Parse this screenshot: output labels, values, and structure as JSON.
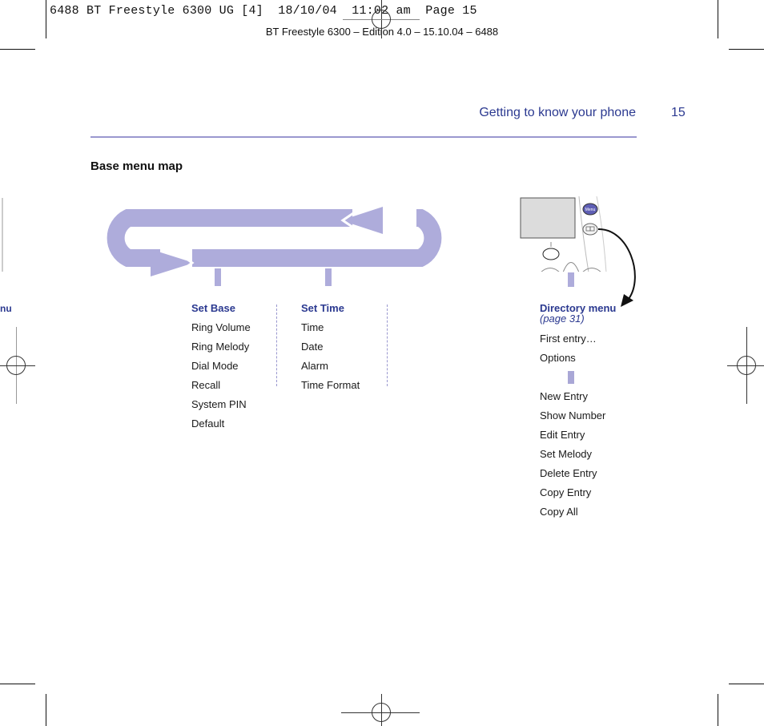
{
  "print_slug": "6488 BT Freestyle 6300 UG [4]  18/10/04  11:02 am  Page 15",
  "edition_line": "BT Freestyle 6300 – Edition 4.0 – 15.10.04 – 6488",
  "header": {
    "chapter_title": "Getting to know your phone",
    "page_number": "15"
  },
  "section": {
    "title": "Base menu map"
  },
  "left_margin_partial_text": "nu",
  "menus": {
    "set_base": {
      "heading": "Set Base",
      "items": [
        "Ring Volume",
        "Ring Melody",
        "Dial Mode",
        "Recall",
        "System PIN",
        "Default"
      ]
    },
    "set_time": {
      "heading": "Set Time",
      "items": [
        "Time",
        "Date",
        "Alarm",
        "Time Format"
      ]
    },
    "directory": {
      "heading": "Directory menu",
      "subheading": "(page 31)",
      "items_top": [
        "First entry…",
        "Options"
      ],
      "items_options": [
        "New Entry",
        "Show Number",
        "Edit Entry",
        "Set Melody",
        "Delete Entry",
        "Copy Entry",
        "Copy All"
      ]
    }
  },
  "handset_illustration": {
    "menu_button_label": "Menu",
    "directory_button_icon": "book-icon"
  },
  "colors": {
    "accent_blue": "#2b3990",
    "loop_lilac": "#aeacdb",
    "rule_lilac": "#9a98cf"
  }
}
